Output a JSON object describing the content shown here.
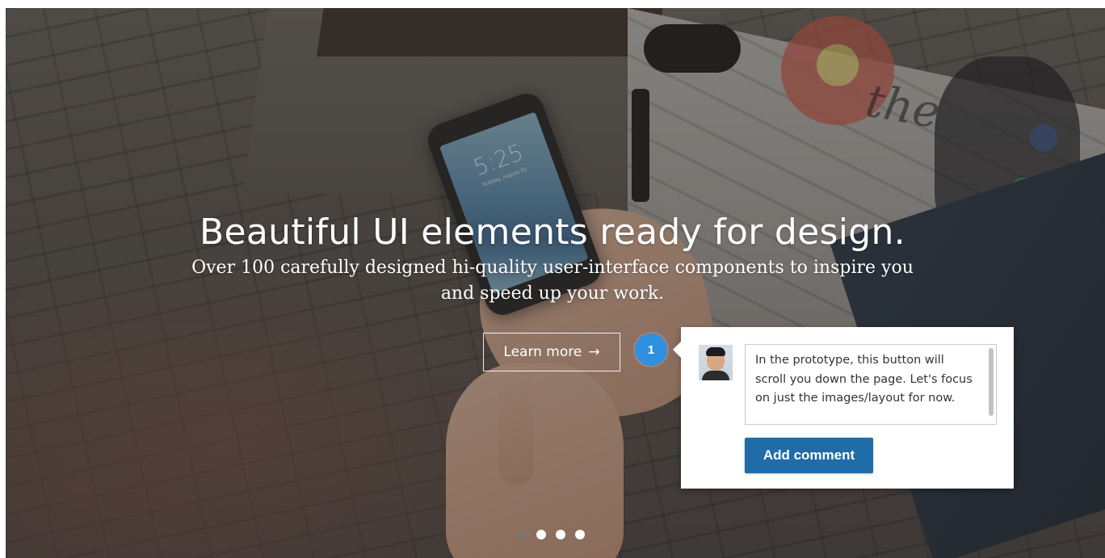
{
  "hero": {
    "title": "Beautiful UI elements ready for design.",
    "subtitle_line1": "Over 100 carefully designed hi-quality user-interface components to inspire you",
    "subtitle_line2": "and speed up your work.",
    "cta_label": "Learn more",
    "cta_icon": "→",
    "phone_time": "5:25",
    "phone_date": "Sunday, August 31",
    "graffiti_text": "the"
  },
  "annotation": {
    "number": "1",
    "comment": "In the prototype, this button will scroll you down the page. Let's focus on just the images/layout for now.",
    "submit_label": "Add comment",
    "accent_color": "#2f8fe0",
    "button_color": "#1f6ca8"
  },
  "carousel": {
    "dots": [
      "inactive",
      "active",
      "active",
      "active"
    ]
  }
}
